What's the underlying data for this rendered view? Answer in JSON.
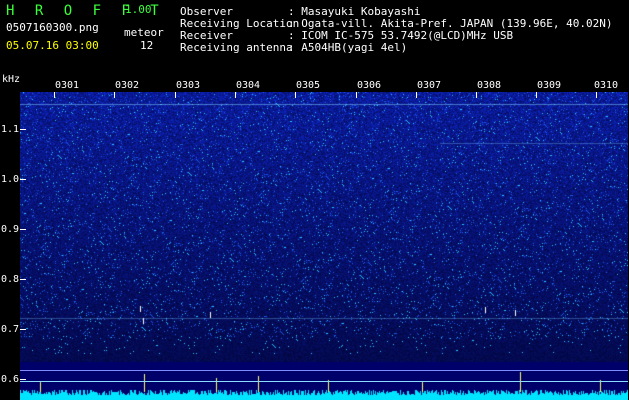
{
  "app": {
    "title": "H R O F F T",
    "version": "1.00",
    "filename": "0507160300.png",
    "datetime": "05.07.16 03:00",
    "meteor_label": "meteor",
    "meteor_count": "12"
  },
  "info": {
    "rows": [
      {
        "label": "Observer",
        "value": ": Masayuki Kobayashi"
      },
      {
        "label": "Receiving Location",
        "value": ": Ogata-vill. Akita-Pref. JAPAN (139.96E, 40.02N)"
      },
      {
        "label": "Receiver",
        "value": ": ICOM IC-575 53.7492(@LCD)MHz USB"
      },
      {
        "label": "Receiving antenna",
        "value": ": A504HB(yagi 4el)"
      }
    ]
  },
  "axes": {
    "y_unit": "kHz",
    "y_ticks": [
      "1.1",
      "1.0",
      "0.9",
      "0.8",
      "0.7",
      "0.6"
    ],
    "x_ticks": [
      "0301",
      "0302",
      "0303",
      "0304",
      "0305",
      "0306",
      "0307",
      "0308",
      "0309",
      "0310"
    ]
  },
  "colors": {
    "background": "#000000",
    "title": "#3cff3c",
    "datetime": "#ffff00",
    "spectrogram_base": "#0a1a8c",
    "noise_floor": "#00e5ff"
  }
}
